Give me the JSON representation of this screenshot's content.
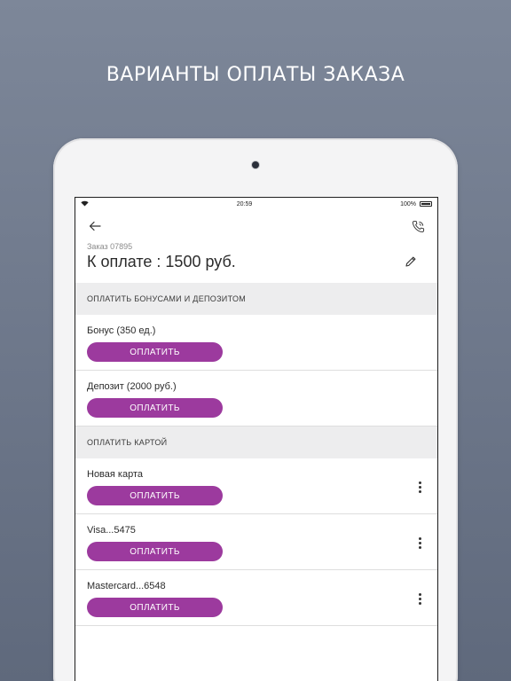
{
  "headline": "ВАРИАНТЫ ОПЛАТЫ ЗАКАЗА",
  "statusbar": {
    "time": "20:59",
    "battery": "100%"
  },
  "icons": {
    "back": "arrow-left-icon",
    "call": "phone-icon",
    "edit": "pencil-icon",
    "more": "more-vertical-icon",
    "wifi": "wifi-icon"
  },
  "order": {
    "number_label": "Заказ 07895",
    "total_label": "К оплате : 1500 руб."
  },
  "colors": {
    "accent": "#9c3a9e",
    "background": "#6e788b",
    "section": "#ededee"
  },
  "sections": [
    {
      "title": "ОПЛАТИТЬ БОНУСАМИ И ДЕПОЗИТОМ",
      "items": [
        {
          "label": "Бонус (350 ед.)",
          "button": "ОПЛАТИТЬ"
        },
        {
          "label": "Депозит (2000 руб.)",
          "button": "ОПЛАТИТЬ"
        }
      ]
    },
    {
      "title": "ОПЛАТИТЬ КАРТОЙ",
      "items": [
        {
          "label": "Новая карта",
          "button": "ОПЛАТИТЬ"
        },
        {
          "label": "Visa...5475",
          "button": "ОПЛАТИТЬ"
        },
        {
          "label": "Mastercard...6548",
          "button": "ОПЛАТИТЬ"
        }
      ]
    }
  ]
}
